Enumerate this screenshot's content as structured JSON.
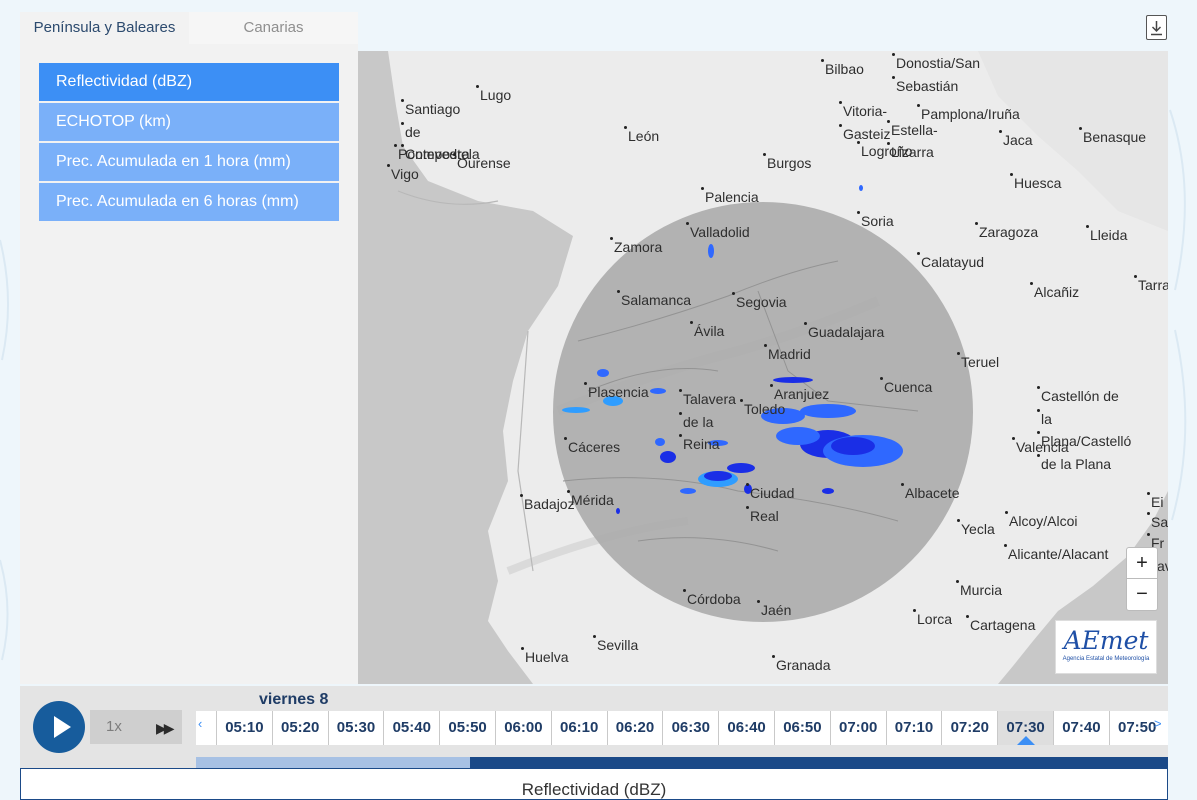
{
  "region_tabs": [
    {
      "label": "Península y Baleares",
      "active": true
    },
    {
      "label": "Canarias",
      "active": false
    }
  ],
  "layers": [
    {
      "label": "Reflectividad (dBZ)",
      "active": true
    },
    {
      "label": "ECHOTOP (km)",
      "active": false
    },
    {
      "label": "Prec. Acumulada en 1 hora (mm)",
      "active": false
    },
    {
      "label": "Prec. Acumulada en 6 horas (mm)",
      "active": false
    }
  ],
  "map": {
    "cities": [
      "Bilbao",
      "Donostia/San",
      "Sebastián",
      "Lugo",
      "Santiago",
      "de",
      "Compostela",
      "Pontevedra",
      "Ourense",
      "Vigo",
      "León",
      "Vitoria-",
      "Gasteiz",
      "Pamplona/Iruña",
      "Estella-",
      "Lizarra",
      "Logroño",
      "Jaca",
      "Benasque",
      "Burgos",
      "Palencia",
      "Huesca",
      "Valladolid",
      "Zamora",
      "Soria",
      "Zaragoza",
      "Lleida",
      "Calatayud",
      "Salamanca",
      "Segovia",
      "Alcañiz",
      "Tarra",
      "Ávila",
      "Guadalajara",
      "Madrid",
      "Teruel",
      "Plasencia",
      "Aranjuez",
      "Cuenca",
      "Talavera",
      "de la",
      "Reina",
      "Toledo",
      "Castellón de",
      "la",
      "Plana/Castelló",
      "de la Plana",
      "Valencia",
      "Cáceres",
      "Ciudad",
      "Real",
      "Albacete",
      "Badajoz",
      "Mérida",
      "Yecla",
      "Alcoy/Alcoi",
      "Alicante/Alacant",
      "Ei",
      "Sa",
      "Fr",
      "av",
      "Murcia",
      "Córdoba",
      "Jaén",
      "Lorca",
      "Cartagena",
      "Sevilla",
      "Huelva",
      "Granada"
    ],
    "zoom_in": "+",
    "zoom_out": "−",
    "logo_text": "AEmet",
    "logo_subtext": "Agencia Estatal de Meteorología",
    "radar_fill": "#a8a8a8",
    "echo_colors": [
      "#1a2ee6",
      "#2f68ff",
      "#2f9dff"
    ]
  },
  "icons": {
    "download": "download-icon",
    "play": "play-icon",
    "fast_forward": "fast-forward-icon"
  },
  "playback": {
    "speed": "1x",
    "ff_glyph": "▶▶"
  },
  "timeline": {
    "day": "viernes 8",
    "times": [
      "05:10",
      "05:20",
      "05:30",
      "05:40",
      "05:50",
      "06:00",
      "06:10",
      "06:20",
      "06:30",
      "06:40",
      "06:50",
      "07:00",
      "07:10",
      "07:20",
      "07:30",
      "07:40",
      "07:50"
    ],
    "current": "07:30",
    "loaded_fraction": 0.282,
    "left_arrow": "‹",
    "right_arrow": ">"
  },
  "legend": {
    "title": "Reflectividad (dBZ)"
  },
  "colors": {
    "accent": "#3c8ff5",
    "accent_light": "#7ab0f9",
    "dark_blue": "#1b4a88",
    "play": "#175c9c"
  }
}
